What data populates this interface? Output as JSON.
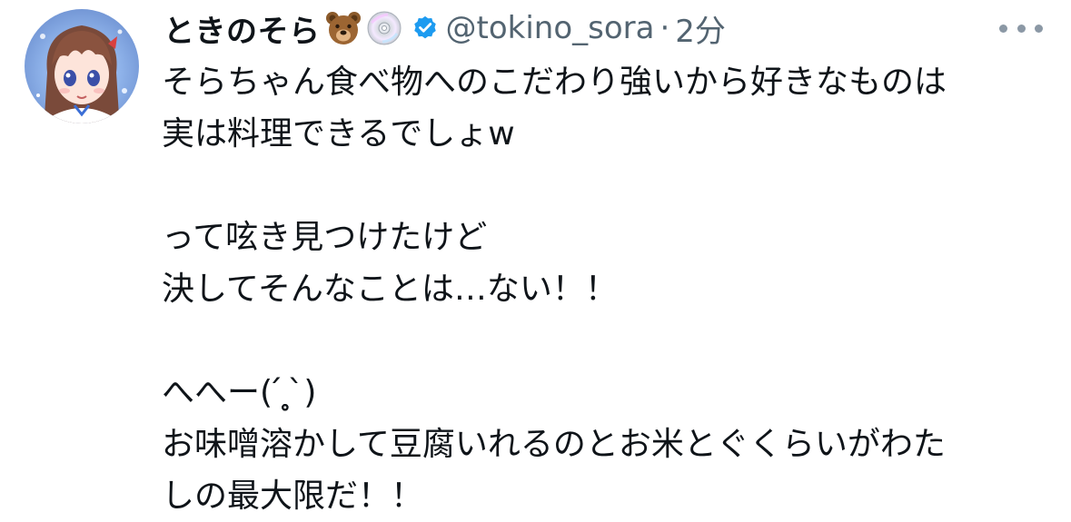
{
  "tweet": {
    "display_name": "ときのそら",
    "name_emojis": [
      "bear-face-emoji",
      "dvd-disc-emoji"
    ],
    "verified": true,
    "handle": "@tokino_sora",
    "separator": "·",
    "time": "2分",
    "more_icon": "more-horizontal-icon",
    "body_lines": [
      "そらちゃん食べ物へのこだわり強いから好きなものは",
      "実は料理できるでしょw",
      "",
      "って呟き見つけたけど",
      "決してそんなことは…ない！！",
      "",
      "へへー( ́ ̥̥̥ ̀)",
      "お味噌溶かして豆腐いれるのとお米とぐくらいがわた",
      "しの最大限だ！！"
    ]
  },
  "colors": {
    "text_primary": "#0f1419",
    "text_secondary": "#536471",
    "verified_blue": "#1d9bf0"
  }
}
